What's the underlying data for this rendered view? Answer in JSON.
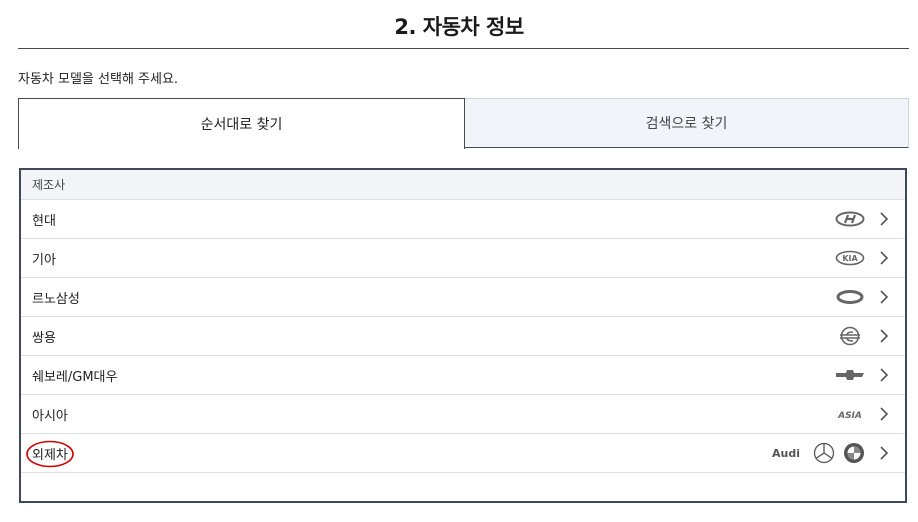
{
  "section": {
    "title": "2. 자동차 정보"
  },
  "instruction": "자동차 모델을 선택해 주세요.",
  "tabs": {
    "sequential": "순서대로 찾기",
    "search": "검색으로 찾기"
  },
  "panel": {
    "header": "제조사",
    "rows": [
      {
        "label": "현대",
        "logo": "hyundai-logo"
      },
      {
        "label": "기아",
        "logo": "kia-logo"
      },
      {
        "label": "르노삼성",
        "logo": "renault-samsung-logo"
      },
      {
        "label": "쌍용",
        "logo": "ssangyong-logo"
      },
      {
        "label": "쉐보레/GM대우",
        "logo": "chevrolet-logo"
      },
      {
        "label": "아시아",
        "logo": "asia-logo"
      },
      {
        "label": "외제차",
        "logo": "audi-mercedes-bmw-logos"
      }
    ]
  },
  "logo_text": {
    "kia": "KIA",
    "asia": "ASIA",
    "audi": "Audi"
  },
  "colors": {
    "border": "#3e4a57",
    "header_bg": "#f2f4f7",
    "tab_inactive_bg": "#f1f4f8",
    "annotation": "#d40000"
  }
}
